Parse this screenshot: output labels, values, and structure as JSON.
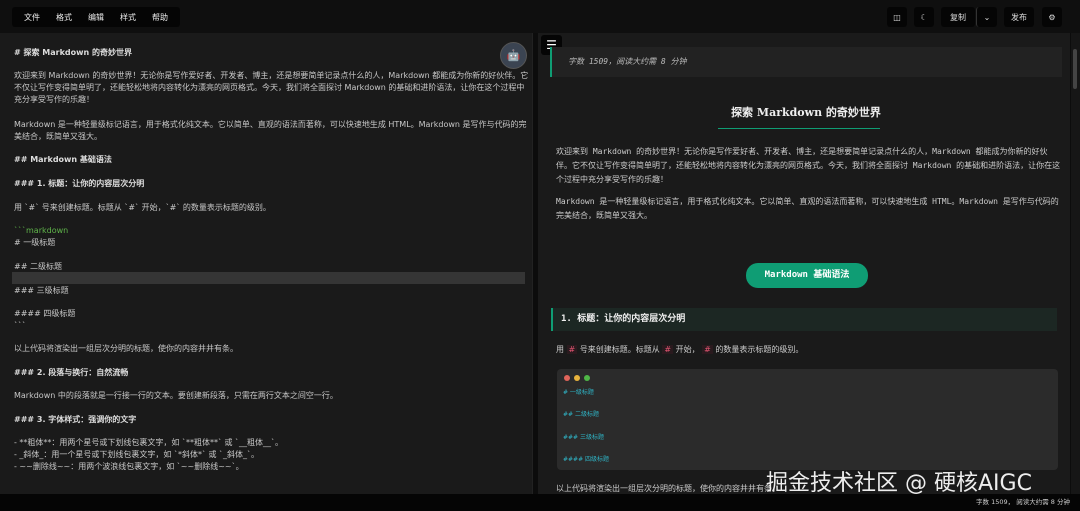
{
  "menu": [
    "文件",
    "格式",
    "编辑",
    "样式",
    "帮助"
  ],
  "toolbar": {
    "copy": "复制",
    "publish": "发布"
  },
  "editor": {
    "lines": [
      {
        "t": "# 探索 Markdown 的奇妙世界",
        "b": true
      },
      {
        "t": "欢迎来到 Markdown 的奇妙世界！无论你是写作爱好者、开发者、博主，还是想要简单记录点什么的人，Markdown 都能成为你新的好伙伴。它"
      },
      {
        "t": "不仅让写作变得简单明了，还能轻松地将内容转化为漂亮的网页格式。今天，我们将全面探讨 Markdown 的基础和进阶语法，让你在这个过程中"
      },
      {
        "t": "充分享受写作的乐趣！"
      },
      {
        "t": "Markdown 是一种轻量级标记语言，用于格式化纯文本。它以简单、直观的语法而著称，可以快速地生成 HTML。Markdown 是写作与代码的完"
      },
      {
        "t": "美结合，既简单又强大。"
      },
      {
        "t": "## Markdown 基础语法",
        "b": true
      },
      {
        "t": "### 1. 标题：让你的内容层次分明",
        "b": true
      },
      {
        "t": "用 `#` 号来创建标题。标题从 `#` 开始，`#` 的数量表示标题的级别。"
      },
      {
        "t": "```markdown",
        "g": true
      },
      {
        "t": "# 一级标题"
      },
      {
        "t": "## 二级标题"
      },
      {
        "t": "### 三级标题"
      },
      {
        "t": "#### 四级标题"
      },
      {
        "t": "```"
      },
      {
        "t": "以上代码将渲染出一组层次分明的标题，使你的内容井井有条。"
      },
      {
        "t": "### 2. 段落与换行：自然流畅",
        "b": true
      },
      {
        "t": "Markdown 中的段落就是一行接一行的文本。要创建新段落，只需在两行文本之间空一行。"
      },
      {
        "t": "### 3. 字体样式：强调你的文字",
        "b": true
      },
      {
        "t": "- **粗体**：用两个星号或下划线包裹文字，如 `**粗体**` 或 `__粗体__`。"
      },
      {
        "t": "- _斜体_：用一个星号或下划线包裹文字，如 `*斜体*` 或 `_斜体_`。"
      },
      {
        "t": "- ~~删除线~~：用两个波浪线包裹文字，如 `~~删除线~~`。"
      }
    ]
  },
  "preview": {
    "quote": "字数 1509，阅读大约需 8 分钟",
    "title": "探索 Markdown 的奇妙世界",
    "p1": "欢迎来到 Markdown 的奇妙世界！无论你是写作爱好者、开发者、博主，还是想要简单记录点什么的人，Markdown 都能成为你新的好伙伴。它不仅让写作变得简单明了，还能轻松地将内容转化为漂亮的网页格式。今天，我们将全面探讨 Markdown 的基础和进阶语法，让你在这个过程中充分享受写作的乐趣！",
    "p2": "Markdown 是一种轻量级标记语言，用于格式化纯文本。它以简单、直观的语法而著称，可以快速地生成 HTML。Markdown 是写作与代码的完美结合，既简单又强大。",
    "h2": "Markdown 基础语法",
    "h3": "1. 标题：让你的内容层次分明",
    "p3": {
      "a": "用",
      "code": "#",
      "b": "号来创建标题。标题从",
      "c": "开始，",
      "d": "的数量表示标题的级别。"
    },
    "code": [
      "# 一级标题",
      "## 二级标题",
      "### 三级标题",
      "#### 四级标题"
    ],
    "p4": "以上代码将渲染出一组层次分明的标题，使你的内容井井有条。"
  },
  "watermark": "掘金技术社区 @ 硬核AIGC",
  "status": "字数 1509， 阅读大约需 8 分钟",
  "colors": {
    "accent": "#0f9d74"
  }
}
